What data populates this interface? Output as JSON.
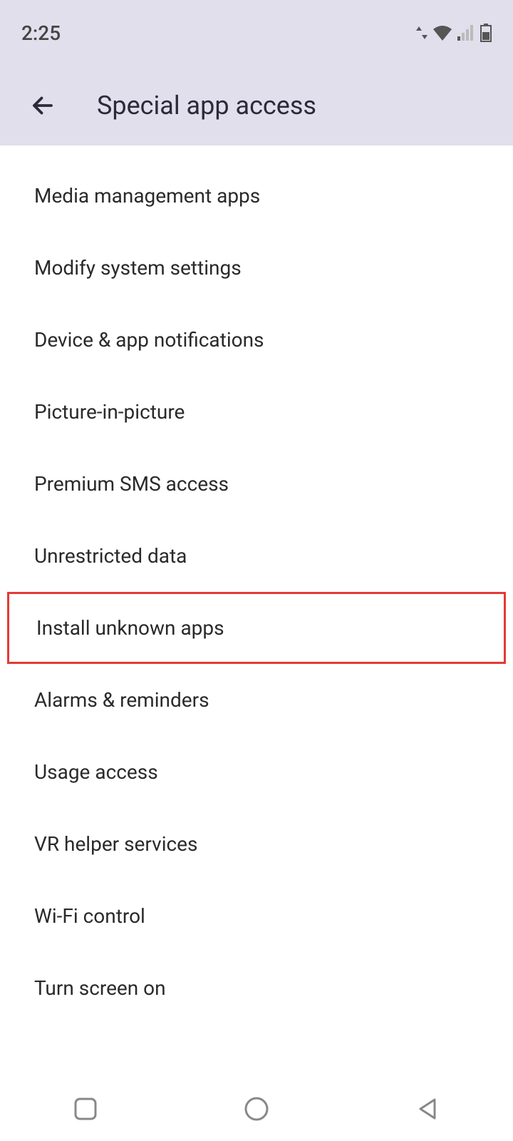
{
  "statusBar": {
    "time": "2:25"
  },
  "header": {
    "title": "Special app access"
  },
  "settings": {
    "items": [
      {
        "label": "Media management apps"
      },
      {
        "label": "Modify system settings"
      },
      {
        "label": "Device & app notifications"
      },
      {
        "label": "Picture-in-picture"
      },
      {
        "label": "Premium SMS access"
      },
      {
        "label": "Unrestricted data"
      },
      {
        "label": "Install unknown apps"
      },
      {
        "label": "Alarms & reminders"
      },
      {
        "label": "Usage access"
      },
      {
        "label": "VR helper services"
      },
      {
        "label": "Wi-Fi control"
      },
      {
        "label": "Turn screen on"
      }
    ]
  }
}
